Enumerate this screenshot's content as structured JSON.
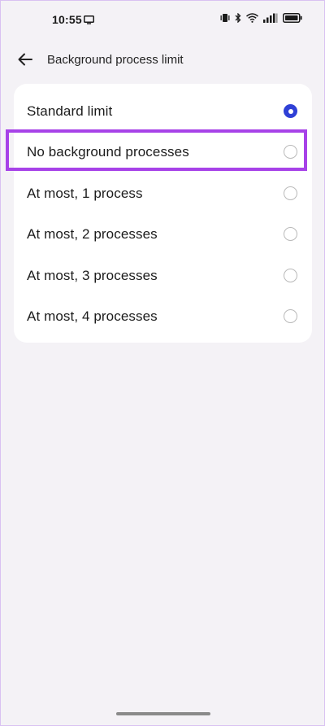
{
  "status_bar": {
    "time": "10:55",
    "icons": [
      "cast-icon",
      "vibrate-icon",
      "bluetooth-icon",
      "wifi-icon",
      "signal-icon",
      "battery-icon"
    ]
  },
  "header": {
    "back_icon": "arrow-left-icon",
    "title": "Background process limit"
  },
  "options": [
    {
      "label": "Standard limit",
      "selected": true
    },
    {
      "label": "No background processes",
      "selected": false
    },
    {
      "label": "At most, 1 process",
      "selected": false
    },
    {
      "label": "At most, 2 processes",
      "selected": false
    },
    {
      "label": "At most, 3 processes",
      "selected": false
    },
    {
      "label": "At most, 4 processes",
      "selected": false
    }
  ],
  "colors": {
    "background": "#f4f2f6",
    "card": "#ffffff",
    "accent": "#2f40d6",
    "highlight": "#a742e8"
  }
}
